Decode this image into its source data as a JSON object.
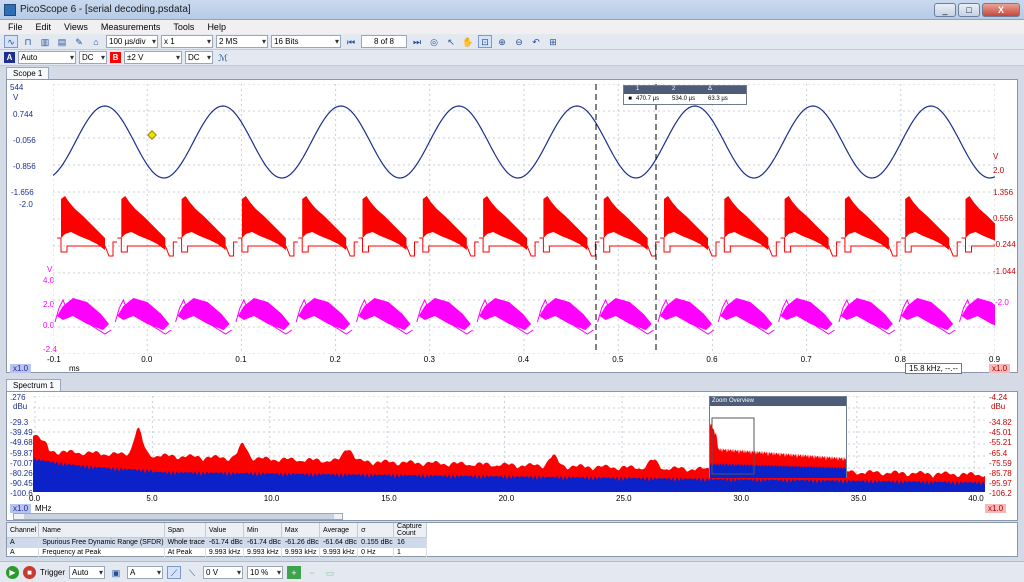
{
  "window": {
    "title": "PicoScope 6 - [serial decoding.psdata]",
    "min": "_",
    "max": "□",
    "close": "X"
  },
  "menu": [
    "File",
    "Edit",
    "Views",
    "Measurements",
    "Tools",
    "Help"
  ],
  "toolbar": {
    "timebase": "100 µs/div",
    "zoom": "x 1",
    "samples": "2 MS",
    "resolution": "16 Bits",
    "capture_page": "8 of 8"
  },
  "channels": {
    "a": {
      "badge": "A",
      "range": "Auto",
      "coupling": "DC"
    },
    "b": {
      "badge": "B",
      "range": "±2 V",
      "coupling": "DC"
    }
  },
  "scope": {
    "tab": "Scope 1",
    "scale_readout": "544",
    "left_axis_a": {
      "unit": "V",
      "ticks": [
        "0.744",
        "-0.056",
        "-0.856",
        "-1.656"
      ]
    },
    "left_axis_b": {
      "top": "-2.0"
    },
    "left_axis_c": {
      "unit": "V",
      "ticks": [
        "4.0",
        "2.0",
        "0.0",
        "-2.4"
      ]
    },
    "right_axis": {
      "unit": "V",
      "ticks": [
        "2.0",
        "1.356",
        "0.556",
        "-0.244",
        "-1.044",
        "-2.0"
      ]
    },
    "x_ticks": [
      "-0.1",
      "0.0",
      "0.1",
      "0.2",
      "0.3",
      "0.4",
      "0.5",
      "0.6",
      "0.7",
      "0.8",
      "0.9"
    ],
    "x_unit": "ms",
    "left_scale_tag": "x1.0",
    "right_scale_tag": "x1.0",
    "ruler_box": {
      "headers": [
        "1",
        "2",
        "Δ"
      ],
      "values": [
        "470.7 µs",
        "534.0 µs",
        "63.3 µs"
      ]
    },
    "freq_readout": "15.8 kHz, --.--"
  },
  "spectrum": {
    "tab": "Spectrum 1",
    "scale_readout": ".276",
    "left_unit": "dBu",
    "left_ticks": [
      "-29.3",
      "-39.49",
      "-49.68",
      "-59.87",
      "-70.07",
      "-80.26",
      "-90.45",
      "-100.6"
    ],
    "right_unit": "dBu",
    "right_ticks": [
      "-4.24",
      "-34.82",
      "-45.01",
      "-55.21",
      "-65.4",
      "-75.59",
      "-85.78",
      "-95.97",
      "-106.2"
    ],
    "x_ticks": [
      "0.0",
      "5.0",
      "10.0",
      "15.0",
      "20.0",
      "25.0",
      "30.0",
      "35.0",
      "40.0"
    ],
    "x_unit": "MHz",
    "left_scale_tag": "x1.0",
    "right_scale_tag": "x1.0",
    "zoom_overview_title": "Zoom Overview"
  },
  "measurements": {
    "headers": [
      "Channel",
      "Name",
      "Span",
      "Value",
      "Min",
      "Max",
      "Average",
      "σ",
      "Capture Count"
    ],
    "rows": [
      [
        "A",
        "Spurious Free Dynamic Range (SFDR)",
        "Whole trace",
        "-61.74 dBc",
        "-61.74 dBc",
        "-61.26 dBc",
        "-61.64 dBc",
        "0.155 dBc",
        "16"
      ],
      [
        "A",
        "Frequency at Peak",
        "At Peak",
        "9.993 kHz",
        "9.993 kHz",
        "9.993 kHz",
        "9.993 kHz",
        "0 Hz",
        "1"
      ]
    ]
  },
  "status": {
    "trigger_label": "Trigger",
    "trigger_mode": "Auto",
    "trigger_source": "A",
    "trigger_level": "0 V",
    "pre_trigger": "10 %"
  },
  "colors": {
    "channel_a": "#1c2f8f",
    "channel_b": "#ff0000",
    "math": "#ff00ff",
    "spectrum_blue": "#0a22c8"
  }
}
